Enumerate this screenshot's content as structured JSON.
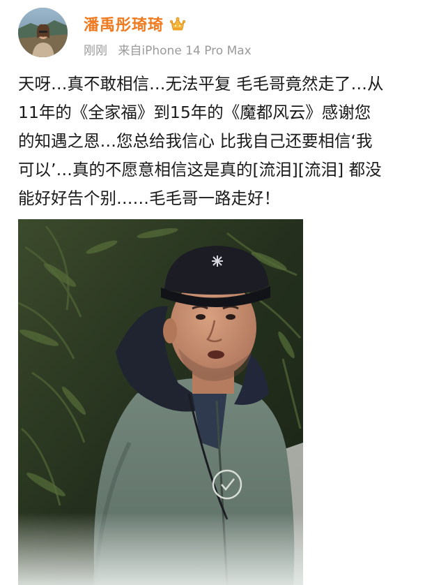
{
  "post": {
    "author": {
      "name": "潘禹彤琦琦",
      "avatar_icon": "profile-avatar",
      "badge_icon": "vip-crown-icon",
      "name_color": "#f07a1f"
    },
    "meta": {
      "time": "刚刚",
      "source": "来自iPhone 14 Pro Max"
    },
    "text_lines": [
      "天呀…真不敢相信…无法平复 毛毛哥竟然走了…从",
      "11年的《全家福》到15年的《魔都风云》感谢您",
      "的知遇之恩…您总给我信心 比我自己还要相信‘我",
      "可以’…真的不愿意相信这是真的[流泪][流泪] 都没",
      "能好好告个别……毛毛哥一路走好！"
    ],
    "image": {
      "subject_icon": "man-in-green-parka-photo"
    }
  }
}
